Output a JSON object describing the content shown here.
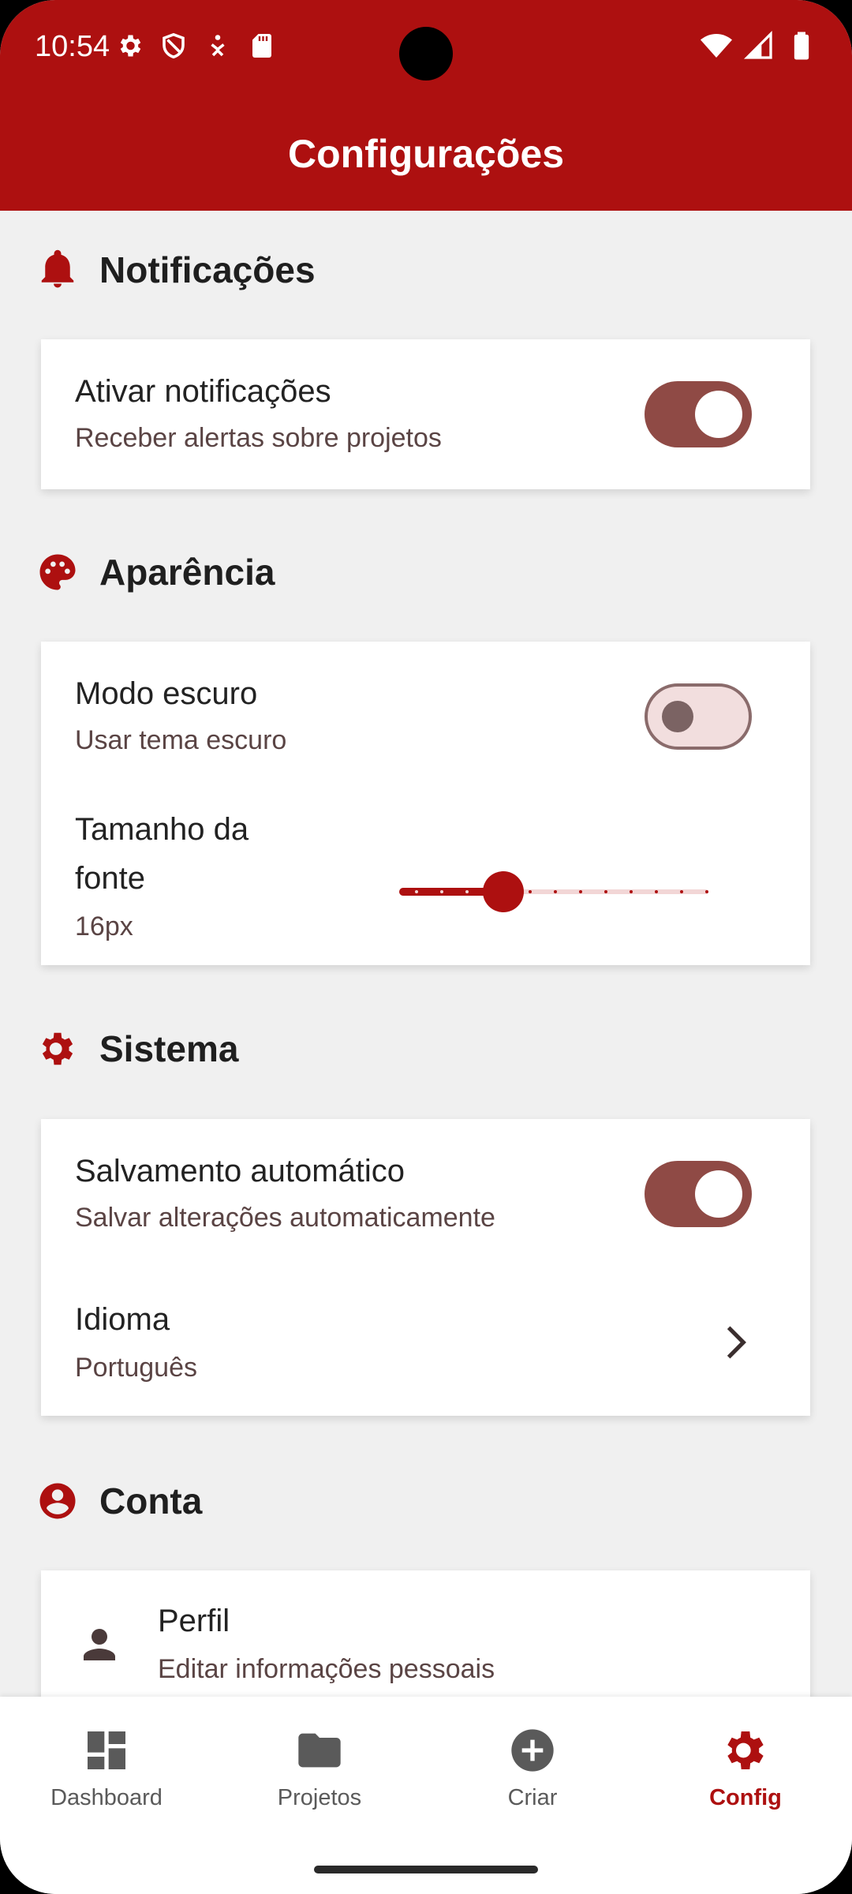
{
  "status_bar": {
    "time": "10:54"
  },
  "app_bar": {
    "title": "Configurações"
  },
  "sections": {
    "notifications": {
      "title": "Notificações",
      "enable": {
        "title": "Ativar notificações",
        "subtitle": "Receber alertas sobre projetos",
        "on": true
      }
    },
    "appearance": {
      "title": "Aparência",
      "dark_mode": {
        "title": "Modo escuro",
        "subtitle": "Usar tema escuro",
        "on": false
      },
      "font_size": {
        "title_line1": "Tamanho da",
        "title_line2": "fonte",
        "value": "16px",
        "slider_fraction": 0.33
      }
    },
    "system": {
      "title": "Sistema",
      "autosave": {
        "title": "Salvamento automático",
        "subtitle": "Salvar alterações automaticamente",
        "on": true
      },
      "language": {
        "title": "Idioma",
        "value": "Português"
      }
    },
    "account": {
      "title": "Conta",
      "profile": {
        "title": "Perfil",
        "subtitle": "Editar informações pessoais"
      }
    }
  },
  "bottom_nav": {
    "items": [
      {
        "label": "Dashboard",
        "icon": "dashboard-icon"
      },
      {
        "label": "Projetos",
        "icon": "folder-icon"
      },
      {
        "label": "Criar",
        "icon": "add-circle-icon"
      },
      {
        "label": "Config",
        "icon": "gear-icon",
        "active": true
      }
    ]
  },
  "colors": {
    "primary": "#ad1010",
    "switch_on": "#8f4a45",
    "background": "#f0f0f0"
  }
}
